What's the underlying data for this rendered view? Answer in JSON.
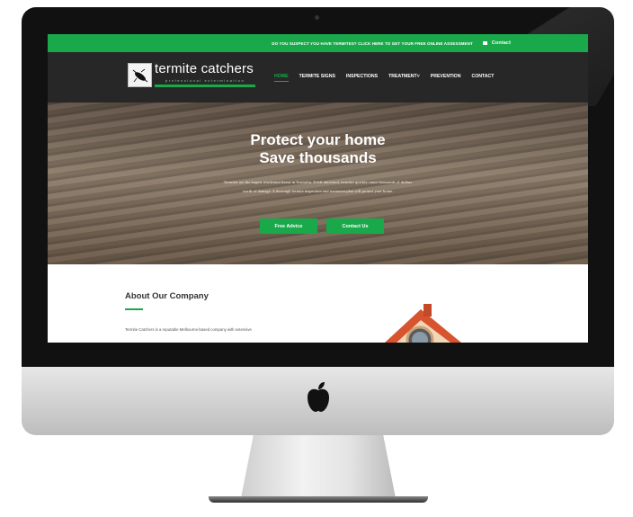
{
  "topbar": {
    "announcement": "DO YOU SUSPECT YOU HAVE TERMITES? CLICK HERE TO GET YOUR FREE ONLINE ASSESSMENT",
    "contact_label": "Contact"
  },
  "logo": {
    "name": "termite catchers",
    "tagline": "professional extermination"
  },
  "nav": {
    "items": [
      {
        "label": "HOME"
      },
      {
        "label": "TERMITE SIGNS"
      },
      {
        "label": "INSPECTIONS"
      },
      {
        "label": "TREATMENT˅"
      },
      {
        "label": "PREVENTION"
      },
      {
        "label": "CONTACT"
      }
    ]
  },
  "hero": {
    "title_line1": "Protect your home",
    "title_line2": "Save thousands",
    "body": "Termites are the largest residential threat in Australia. If left untreated, termites quickly cause thousands of dollars worth of damage. A thorough termite inspection and treatment plan will protect your home.",
    "buttons": [
      {
        "label": "Free Advice"
      },
      {
        "label": "Contact Us"
      }
    ]
  },
  "about": {
    "title": "About Our Company",
    "text": "Termite Catchers is a reputable Melbourne-based company with extensive"
  },
  "colors": {
    "brand_green": "#19a94a",
    "nav_bg": "#272727"
  },
  "icons": [
    "apple-logo-icon",
    "mail-icon",
    "termite-icon",
    "house-icon"
  ]
}
